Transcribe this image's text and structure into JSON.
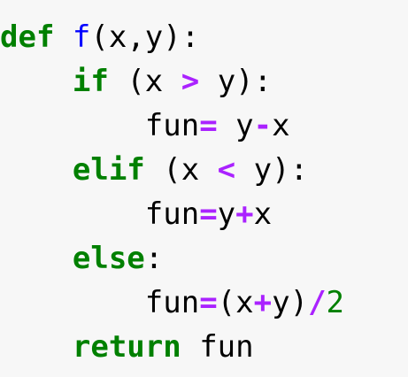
{
  "colors": {
    "background": "#f7f7f7",
    "keyword": "#008000",
    "function_name": "#0000ff",
    "operator": "#aa22ff",
    "number": "#008000",
    "text": "#000000"
  },
  "code_lines": [
    {
      "indent": "",
      "tokens": [
        {
          "type": "keyword",
          "text": "def"
        },
        {
          "type": "text",
          "text": " "
        },
        {
          "type": "function_name",
          "text": "f"
        },
        {
          "type": "text",
          "text": "(x,y):"
        }
      ]
    },
    {
      "indent": "    ",
      "tokens": [
        {
          "type": "keyword",
          "text": "if"
        },
        {
          "type": "text",
          "text": " (x "
        },
        {
          "type": "operator",
          "text": ">"
        },
        {
          "type": "text",
          "text": " y):"
        }
      ]
    },
    {
      "indent": "        ",
      "tokens": [
        {
          "type": "text",
          "text": "fun"
        },
        {
          "type": "operator",
          "text": "="
        },
        {
          "type": "text",
          "text": " y"
        },
        {
          "type": "operator",
          "text": "-"
        },
        {
          "type": "text",
          "text": "x"
        }
      ]
    },
    {
      "indent": "    ",
      "tokens": [
        {
          "type": "keyword",
          "text": "elif"
        },
        {
          "type": "text",
          "text": " (x "
        },
        {
          "type": "operator",
          "text": "<"
        },
        {
          "type": "text",
          "text": " y):"
        }
      ]
    },
    {
      "indent": "        ",
      "tokens": [
        {
          "type": "text",
          "text": "fun"
        },
        {
          "type": "operator",
          "text": "="
        },
        {
          "type": "text",
          "text": "y"
        },
        {
          "type": "operator",
          "text": "+"
        },
        {
          "type": "text",
          "text": "x"
        }
      ]
    },
    {
      "indent": "    ",
      "tokens": [
        {
          "type": "keyword",
          "text": "else"
        },
        {
          "type": "text",
          "text": ":"
        }
      ]
    },
    {
      "indent": "        ",
      "tokens": [
        {
          "type": "text",
          "text": "fun"
        },
        {
          "type": "operator",
          "text": "="
        },
        {
          "type": "text",
          "text": "(x"
        },
        {
          "type": "operator",
          "text": "+"
        },
        {
          "type": "text",
          "text": "y)"
        },
        {
          "type": "operator",
          "text": "/"
        },
        {
          "type": "number",
          "text": "2"
        }
      ]
    },
    {
      "indent": "    ",
      "tokens": [
        {
          "type": "keyword",
          "text": "return"
        },
        {
          "type": "text",
          "text": " fun"
        }
      ]
    }
  ]
}
